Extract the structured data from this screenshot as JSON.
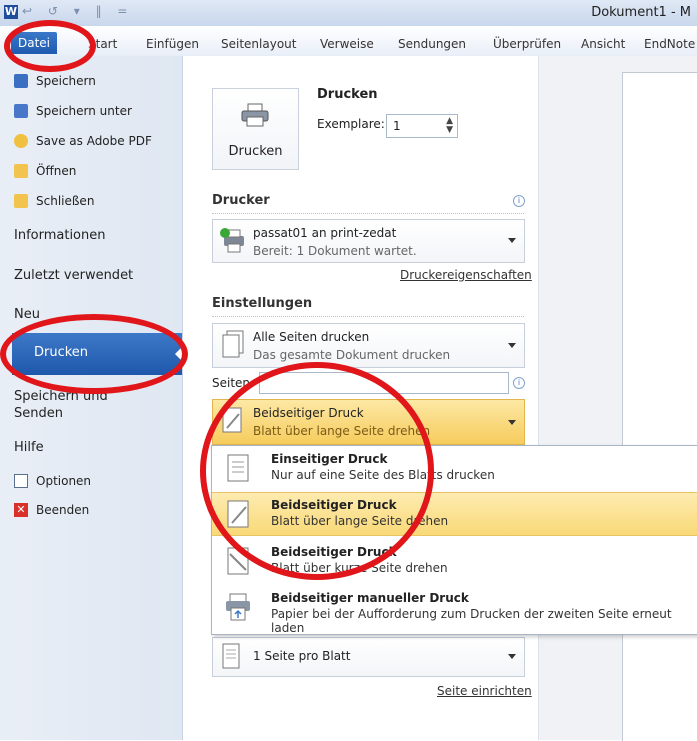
{
  "window": {
    "doc_title": "Dokument1 - M",
    "app_letter": "W",
    "qat": "↩ ↺ ▾ ‖ ="
  },
  "ribbon": {
    "file_tab": "Datei",
    "tabs": [
      "Start",
      "Einfügen",
      "Seitenlayout",
      "Verweise",
      "Sendungen",
      "Überprüfen",
      "Ansicht",
      "EndNote"
    ]
  },
  "backstage": {
    "small_items": [
      "Speichern",
      "Speichern unter",
      "Save as Adobe PDF",
      "Öffnen",
      "Schließen"
    ],
    "informationen": "Informationen",
    "zuletzt": "Zuletzt verwendet",
    "neu": "Neu",
    "drucken": "Drucken",
    "speichern_senden": "Speichern und Senden",
    "hilfe": "Hilfe",
    "optionen": "Optionen",
    "beenden": "Beenden"
  },
  "print": {
    "button_label": "Drucken",
    "heading": "Drucken",
    "copies_label": "Exemplare:",
    "copies_value": "1",
    "printer_heading": "Drucker",
    "printer_name": "passat01 an print-zedat",
    "printer_status": "Bereit: 1 Dokument wartet.",
    "printer_props": "Druckereigenschaften",
    "settings_heading": "Einstellungen",
    "pages_title": "Alle Seiten drucken",
    "pages_desc": "Das gesamte Dokument drucken",
    "seiten_label": "Seiten:",
    "duplex_title": "Beidseitiger Druck",
    "duplex_desc": "Blatt über lange Seite drehen",
    "per_sheet": "1 Seite pro Blatt",
    "page_setup": "Seite einrichten"
  },
  "popup": {
    "options": [
      {
        "title": "Einseitiger Druck",
        "desc": "Nur auf eine Seite des Blatts drucken"
      },
      {
        "title": "Beidseitiger Druck",
        "desc": "Blatt über lange Seite drehen"
      },
      {
        "title": "Beidseitiger Druck",
        "desc": "Blatt über kurze Seite drehen"
      },
      {
        "title": "Beidseitiger manueller Druck",
        "desc": "Papier bei der Aufforderung zum Drucken der zweiten Seite erneut laden"
      }
    ]
  },
  "colors": {
    "accent": "#1f58ab",
    "highlight": "#f9d977",
    "annotation": "#e0161a"
  }
}
